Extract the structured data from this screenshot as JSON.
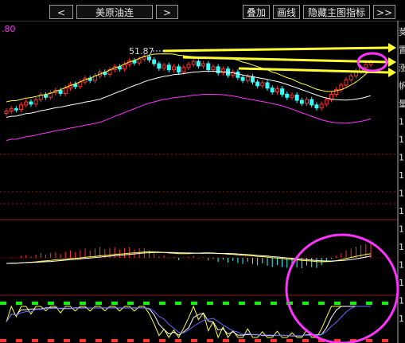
{
  "toolbar": {
    "prev": "<",
    "instrument": "美原油连",
    "next": ">",
    "overlay": "叠加",
    "draw": "画线",
    "hide_indicators": "隐藏主图指标",
    "more": ">>"
  },
  "chart": {
    "level_label": ".80",
    "peak_label": "51.87",
    "right_axis_labels": [
      "荚",
      "置",
      "涨",
      "帆",
      "量",
      "1",
      "1",
      "1",
      "1",
      "1",
      "1",
      "1",
      "1",
      "1",
      "1",
      "1",
      "1"
    ]
  },
  "colors": {
    "bg": "#000000",
    "up": "#ff3333",
    "down": "#33ffff",
    "yellow": "#ffff33",
    "white": "#ffffff",
    "magenta": "#ff33ff",
    "green": "#00ff00",
    "grid": "#8b1a1a"
  },
  "chart_data": {
    "type": "candlestick",
    "title": "美原油连",
    "panels": [
      "price with moving averages and band",
      "MACD",
      "KDJ-type oscillator"
    ],
    "close": [
      44.8,
      45.1,
      45.0,
      45.6,
      46.0,
      45.7,
      46.3,
      46.9,
      46.6,
      47.2,
      47.5,
      47.1,
      47.8,
      48.3,
      48.0,
      48.6,
      49.1,
      48.8,
      49.4,
      49.9,
      49.6,
      50.2,
      50.6,
      50.3,
      50.9,
      51.4,
      51.1,
      51.6,
      51.9,
      51.5,
      51.0,
      50.4,
      50.8,
      50.2,
      50.6,
      49.9,
      50.5,
      50.9,
      51.3,
      50.7,
      51.0,
      50.2,
      50.6,
      49.8,
      50.3,
      49.5,
      49.9,
      49.2,
      48.8,
      49.3,
      48.6,
      48.1,
      48.5,
      47.8,
      47.3,
      47.7,
      47.0,
      46.6,
      46.9,
      46.2,
      45.8,
      46.3,
      45.6,
      45.2,
      45.7,
      46.3,
      47.0,
      47.6,
      48.2,
      48.9,
      49.4,
      50.0,
      50.5,
      50.9,
      51.2
    ]
  }
}
